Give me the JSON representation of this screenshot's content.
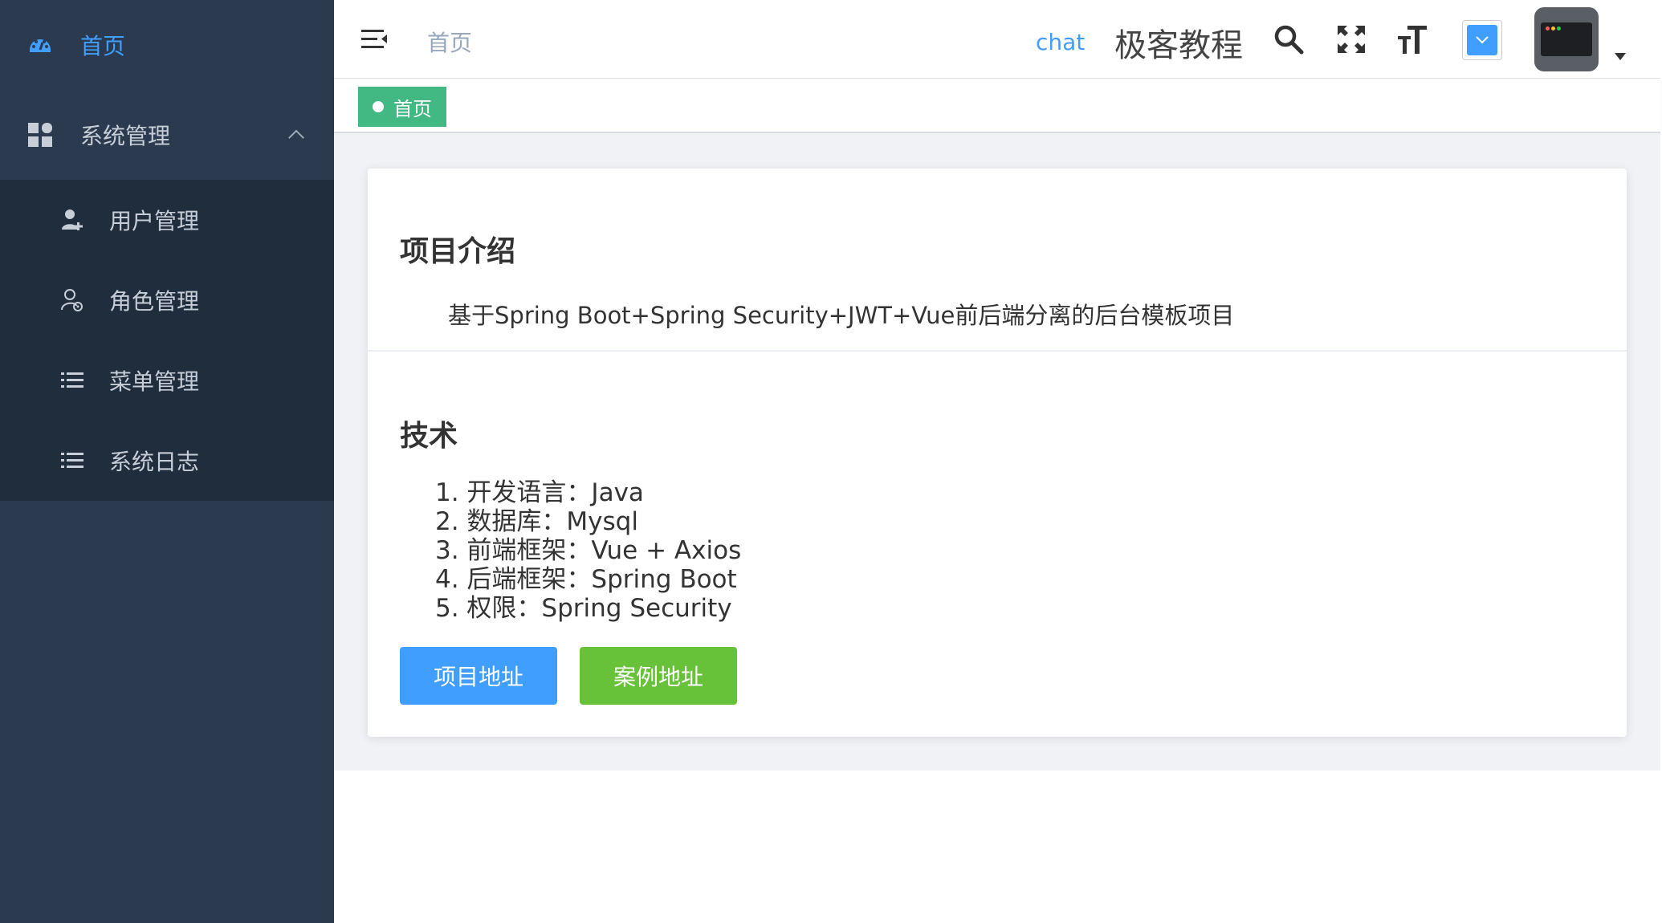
{
  "sidebar": {
    "home_label": "首页",
    "system_label": "系统管理",
    "items": [
      {
        "label": "用户管理",
        "icon": "user-add-icon"
      },
      {
        "label": "角色管理",
        "icon": "role-icon"
      },
      {
        "label": "菜单管理",
        "icon": "list-icon"
      },
      {
        "label": "系统日志",
        "icon": "list-icon"
      }
    ]
  },
  "header": {
    "breadcrumb": "首页",
    "chat": "chat",
    "brand": "极客教程"
  },
  "tags": {
    "active": "首页"
  },
  "content": {
    "intro_title": "项目介绍",
    "intro_text": "基于Spring Boot+Spring Security+JWT+Vue前后端分离的后台模板项目",
    "tech_title": "技术",
    "tech_items": [
      "1. 开发语言：Java",
      "2. 数据库：Mysql",
      "3. 前端框架：Vue + Axios",
      "4. 后端框架：Spring Boot",
      "5. 权限：Spring Security"
    ],
    "btn_project": "项目地址",
    "btn_demo": "案例地址"
  },
  "colors": {
    "sidebar_bg": "#2b3a4f",
    "submenu_bg": "#1f2d3d",
    "accent": "#409eff",
    "tag_green": "#42b983",
    "button_green": "#67c23a"
  }
}
